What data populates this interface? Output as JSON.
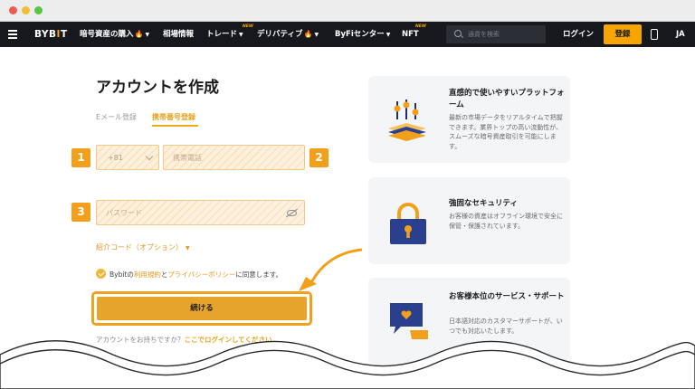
{
  "nav": {
    "logo_main": "BYB",
    "logo_i": "I",
    "logo_end": "T",
    "buy_crypto": "暗号資産の購入",
    "market": "相場情報",
    "trade": "トレード",
    "derivatives": "デリバティブ",
    "byfi": "ByFiセンター",
    "nft": "NFT",
    "new_badge": "NEW",
    "search_placeholder": "通貨を検索",
    "login": "ログイン",
    "register": "登録",
    "language": "JA"
  },
  "form": {
    "title": "アカウントを作成",
    "tab_email": "Eメール登録",
    "tab_phone": "携帯番号登録",
    "country_code": "+81",
    "phone_placeholder": "携帯電話",
    "password_placeholder": "パスワード",
    "referral": "紹介コード（オプション）",
    "agree_prefix": "Bybitの",
    "terms_link": "利用規約",
    "agree_and": "と",
    "privacy_link": "プライバシーポリシー",
    "agree_suffix": "に同意します。",
    "continue": "続ける",
    "have_account": "アカウントをお持ちですか？",
    "login_link": "ここでログインしてください"
  },
  "steps": [
    "1",
    "2",
    "3"
  ],
  "cards": [
    {
      "title": "直感的で使いやすいプラットフォーム",
      "desc": "最新の市場データをリアルタイムで把握できます。業界トップの高い流動性が、スムーズな暗号資産取引を可能にします。",
      "icon": "trading-platform-icon"
    },
    {
      "title": "強固なセキュリティ",
      "desc": "お客様の資産はオフライン環境で安全に保管・保護されています。",
      "icon": "padlock-icon"
    },
    {
      "title": "お客様本位のサービス・サポート",
      "desc": "日本語対応のカスタマーサポートが、いつでも対応いたします。",
      "icon": "chat-support-icon"
    }
  ],
  "colors": {
    "accent": "#f7a600",
    "navbar": "#17181e",
    "button": "#e7a42c"
  }
}
